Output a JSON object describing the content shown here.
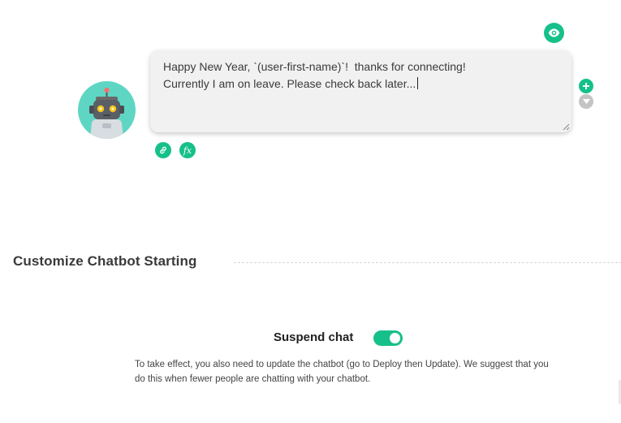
{
  "message_editor": {
    "text": "Happy New Year, `(user-first-name)`!  thanks for connecting!\nCurrently I am on leave. Please check back later...",
    "preview_icon": "eye-icon",
    "add_icon": "plus-icon",
    "move_icon": "caret-down-icon",
    "link_icon": "link-icon",
    "function_icon": "function-icon",
    "function_glyph": "fx"
  },
  "customize_section": {
    "title": "Customize Chatbot Starting"
  },
  "suspend": {
    "label": "Suspend chat",
    "enabled": true,
    "notice": "To take effect, you also need to update the chatbot (go to Deploy then Update). We suggest that you do this when fewer people are chatting with your chatbot."
  },
  "colors": {
    "accent": "#16c08a",
    "avatar_bg": "#5fd6c3",
    "editor_bg": "#f1f1f1"
  }
}
